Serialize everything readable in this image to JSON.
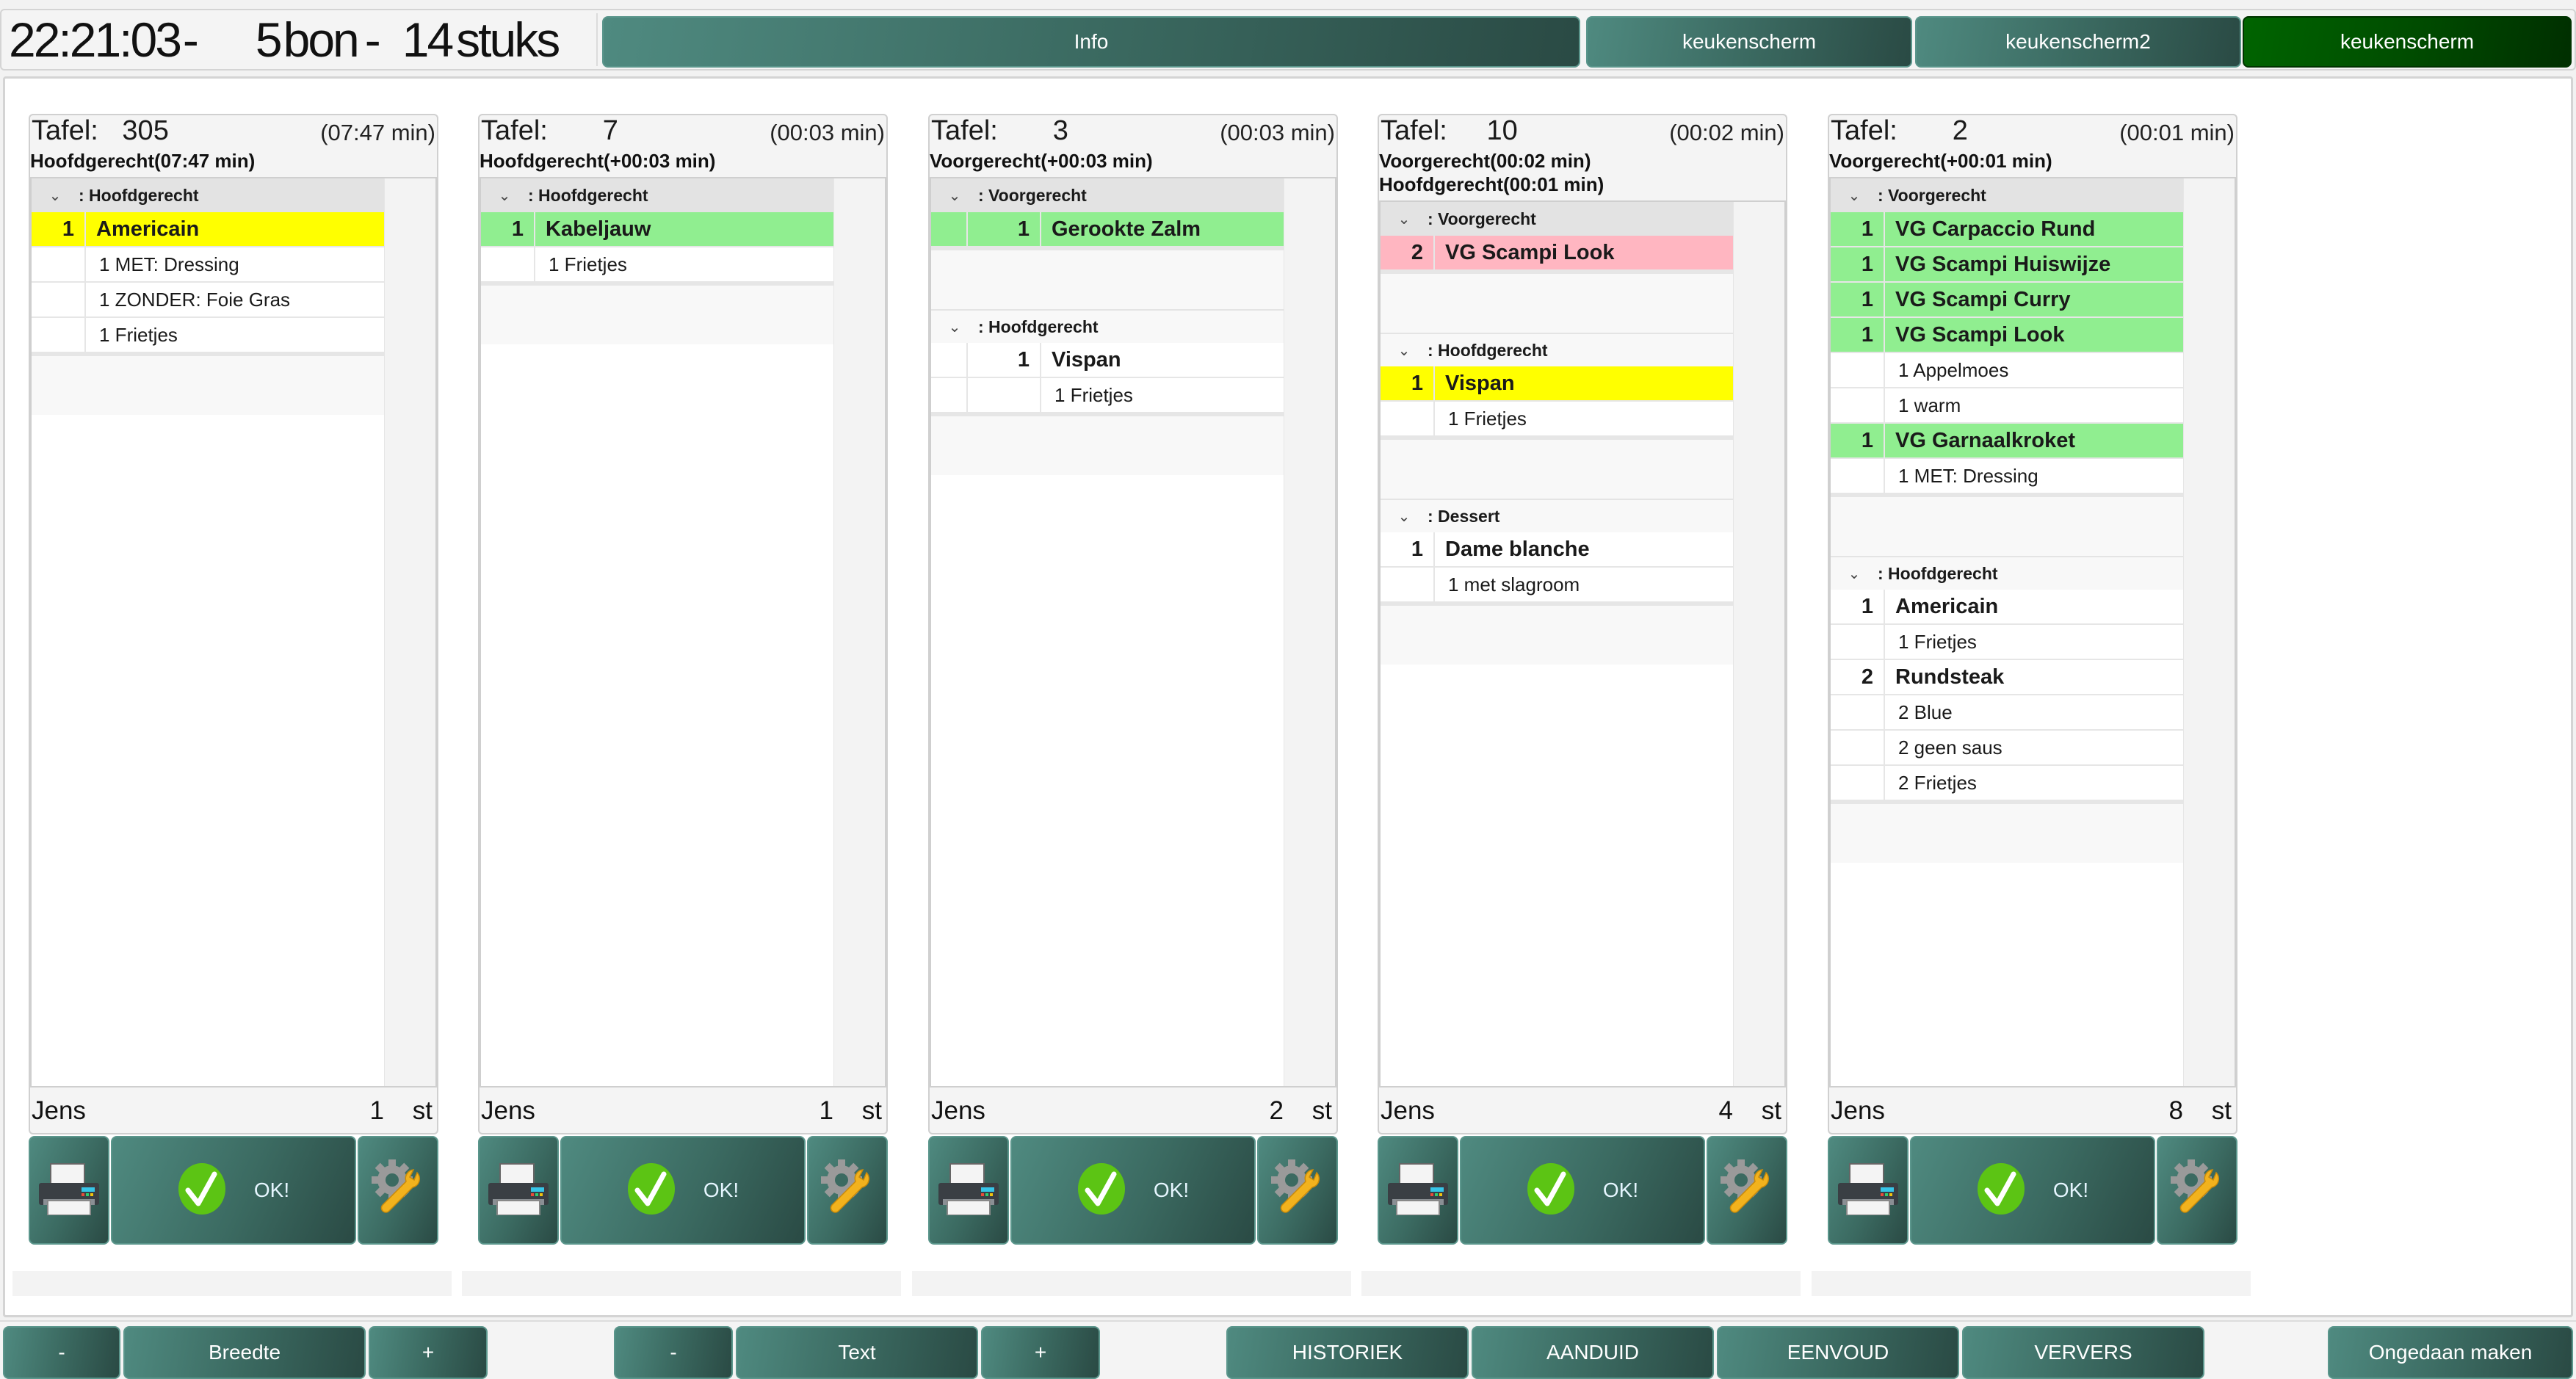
{
  "header": {
    "time": "22:21:03",
    "separator": "-",
    "bon_count": "5",
    "bon_label": "bon",
    "stuks_count": "14",
    "stuks_label": "stuks",
    "nav": [
      {
        "label": "Info",
        "active": false
      },
      {
        "label": "keukenscherm",
        "active": false
      },
      {
        "label": "keukenscherm2",
        "active": false
      },
      {
        "label": "keukenscherm",
        "active": true
      }
    ]
  },
  "colors": {
    "button_teal": "#3b6a61",
    "active_green": "#006400",
    "row_yellow": "#ffff00",
    "row_green": "#90ee90",
    "row_pink": "#ffb6c1"
  },
  "cards": [
    {
      "table_label": "Tafel:",
      "table_number": "305",
      "elapsed": "(07:47 min)",
      "course_lines": [
        "Hoofdgerecht(07:47 min)"
      ],
      "waiter": "Jens",
      "count": "1",
      "unit": "st",
      "ok_label": "OK!",
      "groups": [
        {
          "name": ": Hoofdgerecht",
          "rows": [
            {
              "qty": "1",
              "name": "Americain",
              "kind": "item",
              "status": "yellow"
            },
            {
              "qty": "",
              "name": "1 MET: Dressing",
              "kind": "mod",
              "status": ""
            },
            {
              "qty": "",
              "name": "1 ZONDER: Foie Gras",
              "kind": "mod",
              "status": ""
            },
            {
              "qty": "",
              "name": "1 Frietjes",
              "kind": "mod",
              "status": ""
            }
          ]
        }
      ]
    },
    {
      "table_label": "Tafel:",
      "table_number": "7",
      "elapsed": "(00:03 min)",
      "course_lines": [
        "Hoofdgerecht(+00:03 min)"
      ],
      "waiter": "Jens",
      "count": "1",
      "unit": "st",
      "ok_label": "OK!",
      "groups": [
        {
          "name": ": Hoofdgerecht",
          "rows": [
            {
              "qty": "1",
              "name": "Kabeljauw",
              "kind": "item",
              "status": "green"
            },
            {
              "qty": "",
              "name": "1 Frietjes",
              "kind": "mod",
              "status": ""
            }
          ]
        }
      ]
    },
    {
      "table_label": "Tafel:",
      "table_number": "3",
      "elapsed": "(00:03 min)",
      "course_lines": [
        "Voorgerecht(+00:03 min)"
      ],
      "waiter": "Jens",
      "count": "2",
      "unit": "st",
      "ok_label": "OK!",
      "indent": true,
      "groups": [
        {
          "name": ": Voorgerecht",
          "rows": [
            {
              "qty": "1",
              "name": "Gerookte Zalm",
              "kind": "item",
              "status": "green"
            }
          ]
        },
        {
          "name": ": Hoofdgerecht",
          "rows": [
            {
              "qty": "1",
              "name": "Vispan",
              "kind": "item",
              "status": ""
            },
            {
              "qty": "",
              "name": "1 Frietjes",
              "kind": "mod",
              "status": ""
            }
          ]
        }
      ]
    },
    {
      "table_label": "Tafel:",
      "table_number": "10",
      "elapsed": "(00:02 min)",
      "course_lines": [
        "Voorgerecht(00:02 min)",
        "Hoofdgerecht(00:01 min)"
      ],
      "waiter": "Jens",
      "count": "4",
      "unit": "st",
      "ok_label": "OK!",
      "groups": [
        {
          "name": ": Voorgerecht",
          "rows": [
            {
              "qty": "2",
              "name": "VG Scampi Look",
              "kind": "item",
              "status": "pink"
            }
          ]
        },
        {
          "name": ": Hoofdgerecht",
          "rows": [
            {
              "qty": "1",
              "name": "Vispan",
              "kind": "item",
              "status": "yellow"
            },
            {
              "qty": "",
              "name": "1 Frietjes",
              "kind": "mod",
              "status": ""
            }
          ]
        },
        {
          "name": ": Dessert",
          "rows": [
            {
              "qty": "1",
              "name": "Dame blanche",
              "kind": "item",
              "status": ""
            },
            {
              "qty": "",
              "name": "1 met slagroom",
              "kind": "mod",
              "status": ""
            }
          ]
        }
      ]
    },
    {
      "table_label": "Tafel:",
      "table_number": "2",
      "elapsed": "(00:01 min)",
      "course_lines": [
        "Voorgerecht(+00:01 min)"
      ],
      "waiter": "Jens",
      "count": "8",
      "unit": "st",
      "ok_label": "OK!",
      "groups": [
        {
          "name": ": Voorgerecht",
          "rows": [
            {
              "qty": "1",
              "name": "VG Carpaccio Rund",
              "kind": "item",
              "status": "green"
            },
            {
              "qty": "1",
              "name": "VG Scampi Huiswijze",
              "kind": "item",
              "status": "green"
            },
            {
              "qty": "1",
              "name": "VG Scampi Curry",
              "kind": "item",
              "status": "green"
            },
            {
              "qty": "1",
              "name": "VG Scampi Look",
              "kind": "item",
              "status": "green"
            },
            {
              "qty": "",
              "name": "1 Appelmoes",
              "kind": "mod",
              "status": ""
            },
            {
              "qty": "",
              "name": "1 warm",
              "kind": "mod",
              "status": ""
            },
            {
              "qty": "1",
              "name": "VG Garnaalkroket",
              "kind": "item",
              "status": "green"
            },
            {
              "qty": "",
              "name": "1 MET: Dressing",
              "kind": "mod",
              "status": ""
            }
          ]
        },
        {
          "name": ": Hoofdgerecht",
          "rows": [
            {
              "qty": "1",
              "name": "Americain",
              "kind": "item",
              "status": ""
            },
            {
              "qty": "",
              "name": "1 Frietjes",
              "kind": "mod",
              "status": ""
            },
            {
              "qty": "2",
              "name": "Rundsteak",
              "kind": "item",
              "status": ""
            },
            {
              "qty": "",
              "name": "2 Blue",
              "kind": "mod",
              "status": ""
            },
            {
              "qty": "",
              "name": "2 geen saus",
              "kind": "mod",
              "status": ""
            },
            {
              "qty": "",
              "name": "2 Frietjes",
              "kind": "mod",
              "status": ""
            }
          ]
        }
      ]
    }
  ],
  "toolbar": {
    "width_minus": "-",
    "width_label": "Breedte",
    "width_plus": "+",
    "text_minus": "-",
    "text_label": "Text",
    "text_plus": "+",
    "historiek": "HISTORIEK",
    "aanduid": "AANDUID",
    "eenvoud": "EENVOUD",
    "ververs": "VERVERS",
    "undo": "Ongedaan maken"
  }
}
